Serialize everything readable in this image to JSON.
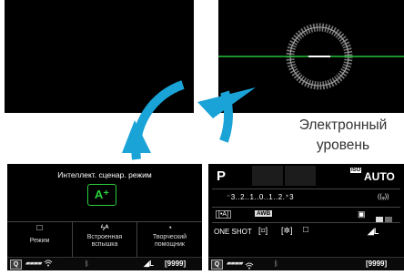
{
  "caption": {
    "line1": "Электронный",
    "line2": "уровень"
  },
  "colors": {
    "arrow": "#1aa3d6",
    "level_line": "#27c23a",
    "accent_green": "#29d03c"
  },
  "screen_bl": {
    "title": "Интеллект. сценар. режим",
    "mode_icon": "A⁺",
    "items": [
      {
        "icon": "□",
        "label": "Режим"
      },
      {
        "icon": "ϟᴬ",
        "label": "Встроенная\nвспышка"
      },
      {
        "icon": "◔",
        "label": "Творческий\nпомощник"
      }
    ],
    "status": {
      "q": "Q",
      "battery": "▰▰▰▰",
      "wifi_icon": "wifi-off-icon",
      "bt": "ᛒ",
      "quality": "◢L",
      "shots": "[9999]"
    }
  },
  "screen_br": {
    "mode": "P",
    "iso_label": "ISO",
    "iso_value": "AUTO",
    "exposure_scale": "⁻3..2..1..0..1..2.⁺3",
    "wifi": "((ᵩ))",
    "metering": "[•A]",
    "wb": "AWB",
    "picture_style": "▣",
    "af_mode": "ONE SHOT",
    "af_area": "[⌗]",
    "metering2": "[✲]",
    "drive": "□",
    "quality": "◢L",
    "status": {
      "q": "Q",
      "battery": "▰▰▰▰",
      "bt": "ᛒ",
      "shots": "[9999]"
    }
  }
}
